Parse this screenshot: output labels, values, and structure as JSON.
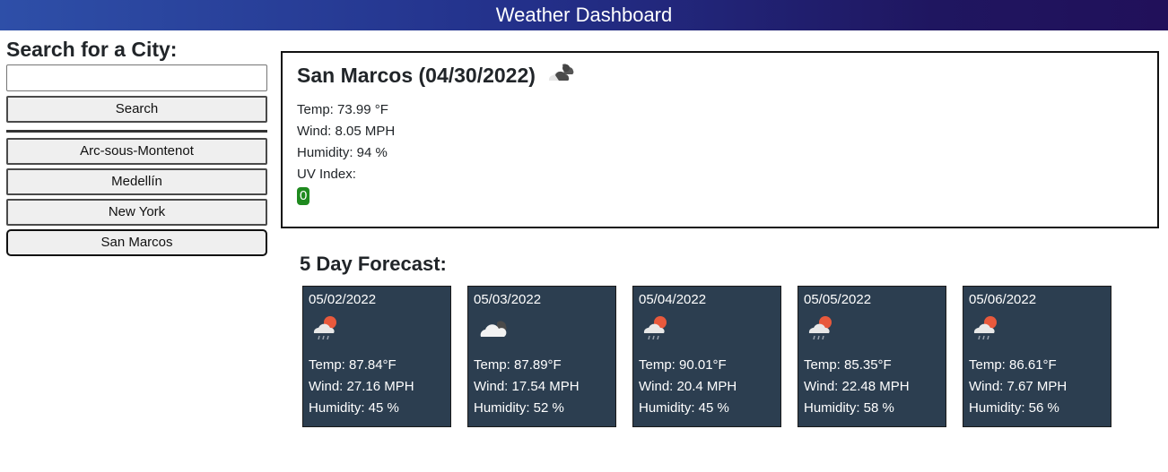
{
  "header": {
    "title": "Weather Dashboard"
  },
  "sidebar": {
    "title": "Search for a City:",
    "search_value": "",
    "search_placeholder": "",
    "search_button": "Search",
    "history": [
      {
        "label": "Arc-sous-Montenot"
      },
      {
        "label": "Medellín"
      },
      {
        "label": "New York"
      },
      {
        "label": "San Marcos"
      }
    ]
  },
  "current": {
    "heading": "San Marcos (04/30/2022)",
    "icon": "partly-cloudy-night-icon",
    "temp": "Temp: 73.99 °F",
    "wind": "Wind: 8.05 MPH",
    "humidity": "Humidity: 94 %",
    "uv_label": "UV Index:",
    "uv_value": "0",
    "uv_color": "#1f8a1f"
  },
  "forecast": {
    "title": "5 Day Forecast:",
    "days": [
      {
        "date": "05/02/2022",
        "icon": "sun-cloud-rain-icon",
        "temp": "Temp: 87.84°F",
        "wind": "Wind: 27.16 MPH",
        "humidity": "Humidity: 45 %"
      },
      {
        "date": "05/03/2022",
        "icon": "cloud-night-icon",
        "temp": "Temp: 87.89°F",
        "wind": "Wind: 17.54 MPH",
        "humidity": "Humidity: 52 %"
      },
      {
        "date": "05/04/2022",
        "icon": "sun-cloud-rain-icon",
        "temp": "Temp: 90.01°F",
        "wind": "Wind: 20.4 MPH",
        "humidity": "Humidity: 45 %"
      },
      {
        "date": "05/05/2022",
        "icon": "sun-cloud-rain-icon",
        "temp": "Temp: 85.35°F",
        "wind": "Wind: 22.48 MPH",
        "humidity": "Humidity: 58 %"
      },
      {
        "date": "05/06/2022",
        "icon": "sun-cloud-rain-icon",
        "temp": "Temp: 86.61°F",
        "wind": "Wind: 7.67 MPH",
        "humidity": "Humidity: 56 %"
      }
    ],
    "card_color": "#2c3e50"
  }
}
